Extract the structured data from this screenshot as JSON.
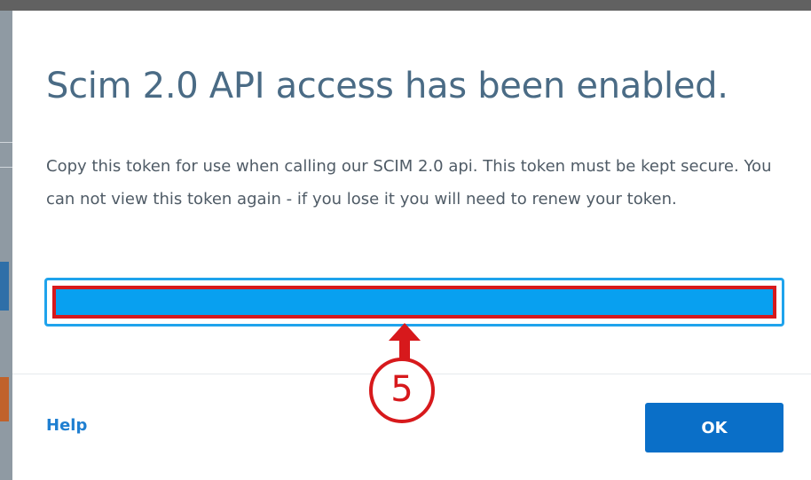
{
  "dialog": {
    "title": "Scim 2.0 API access has been enabled.",
    "body": "Copy this token for use when calling our SCIM 2.0 api. This token must be kept secure. You can not view this token again - if you lose it you will need to renew your token.",
    "token_value": ""
  },
  "annotation": {
    "step_number": "5",
    "color": "#d7191c"
  },
  "footer": {
    "help_label": "Help",
    "ok_label": "OK"
  },
  "colors": {
    "title": "#4a6b85",
    "token_fill": "#08a0f0",
    "token_border": "#1fa3ec",
    "primary_button": "#0a6fc8",
    "link": "#1f7fd1"
  }
}
